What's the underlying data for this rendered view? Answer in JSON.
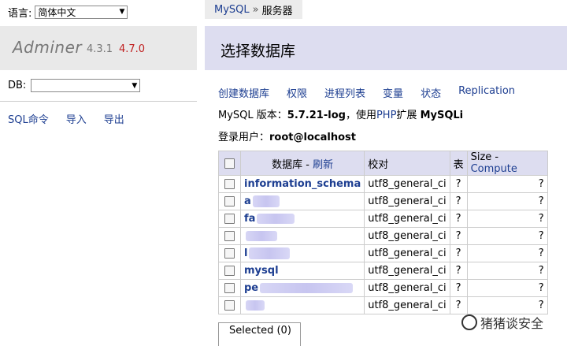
{
  "sidebar": {
    "lang_label": "语言:",
    "lang_value": "简体中文",
    "app_name": "Adminer",
    "version": "4.3.1",
    "new_version": "4.7.0",
    "db_label": "DB:",
    "db_value": "",
    "links": [
      "SQL命令",
      "导入",
      "导出"
    ]
  },
  "breadcrumb": {
    "items": [
      "MySQL",
      "服务器"
    ],
    "separator": "»"
  },
  "page_title": "选择数据库",
  "actions": [
    "创建数据库",
    "权限",
    "进程列表",
    "变量",
    "状态",
    "Replication"
  ],
  "version_line": {
    "prefix": "MySQL 版本：",
    "version": "5.7.21-log",
    "middle": "，使用",
    "php": "PHP",
    "ext_label": "扩展",
    "ext": "MySQLi"
  },
  "user_line": {
    "prefix": "登录用户：",
    "user": "root@localhost"
  },
  "table": {
    "headers": {
      "db": "数据库",
      "dash": " - ",
      "refresh": "刷新",
      "collation": "校对",
      "tables": "表",
      "size": "Size",
      "compute": "Compute"
    },
    "rows": [
      {
        "name": "information_schema",
        "collation": "utf8_general_ci",
        "tables": "?",
        "size": "?"
      },
      {
        "name": "a",
        "collation": "utf8_general_ci",
        "tables": "?",
        "size": "?"
      },
      {
        "name": "fa",
        "collation": "utf8_general_ci",
        "tables": "?",
        "size": "?"
      },
      {
        "name": "",
        "collation": "utf8_general_ci",
        "tables": "?",
        "size": "?"
      },
      {
        "name": "l",
        "collation": "utf8_general_ci",
        "tables": "?",
        "size": "?"
      },
      {
        "name": "mysql",
        "collation": "utf8_general_ci",
        "tables": "?",
        "size": "?"
      },
      {
        "name": "pe",
        "collation": "utf8_general_ci",
        "tables": "?",
        "size": "?"
      },
      {
        "name": "",
        "collation": "utf8_general_ci",
        "tables": "?",
        "size": "?"
      }
    ]
  },
  "selected_label": "Selected (0)",
  "watermark": "猪猪谈安全",
  "icons": {
    "dropdown": "chevron-down-icon",
    "watermark": "wechat-icon"
  }
}
